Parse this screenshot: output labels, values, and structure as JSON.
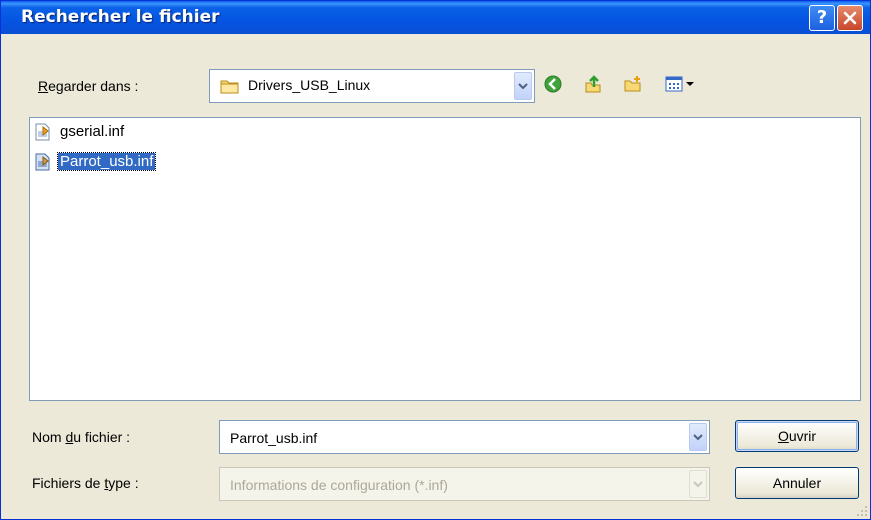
{
  "dialog": {
    "title": "Rechercher le fichier",
    "help_button": "?",
    "close_button": "close"
  },
  "look_in": {
    "label_underlined": "R",
    "label_rest": "egarder dans :",
    "value": "Drivers_USB_Linux",
    "icons": [
      "folder-icon",
      "back-icon",
      "up-folder-icon",
      "new-folder-icon",
      "view-menu-icon"
    ]
  },
  "files": [
    {
      "name": "gserial.inf",
      "selected": false,
      "icon": "inf-file-icon"
    },
    {
      "name": "Parrot_usb.inf",
      "selected": true,
      "icon": "inf-file-icon"
    }
  ],
  "filename_field": {
    "label_before": "Nom ",
    "label_underlined": "d",
    "label_after": "u fichier :",
    "value": "Parrot_usb.inf"
  },
  "filetype_field": {
    "label_before": "Fichiers de ",
    "label_underlined": "t",
    "label_after": "ype :",
    "value": "Informations de configuration (*.inf)",
    "disabled": true
  },
  "buttons": {
    "open_underlined": "O",
    "open_rest": "uvrir",
    "cancel": "Annuler"
  },
  "colors": {
    "titlebar": "#0a5ee9",
    "selection": "#316ac5",
    "dialog_bg": "#ece9d8"
  }
}
